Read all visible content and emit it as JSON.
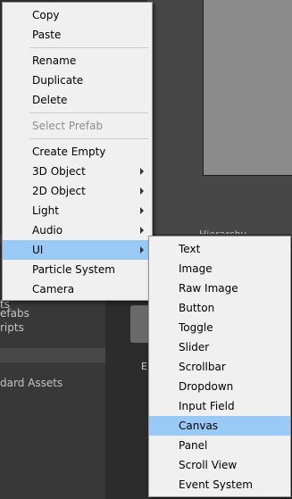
{
  "background": {
    "scene_label": "Hierarchy",
    "project_rows": [
      "ts",
      "efabs",
      "ripts",
      "dard Assets"
    ],
    "asset_label": "E"
  },
  "context_menu": {
    "items": [
      {
        "label": "Copy"
      },
      {
        "label": "Paste"
      },
      {
        "label": "Rename"
      },
      {
        "label": "Duplicate"
      },
      {
        "label": "Delete"
      },
      {
        "label": "Select Prefab",
        "disabled": true
      },
      {
        "label": "Create Empty"
      },
      {
        "label": "3D Object",
        "submenu": true
      },
      {
        "label": "2D Object",
        "submenu": true
      },
      {
        "label": "Light",
        "submenu": true
      },
      {
        "label": "Audio",
        "submenu": true
      },
      {
        "label": "UI",
        "submenu": true,
        "highlighted": true
      },
      {
        "label": "Particle System"
      },
      {
        "label": "Camera"
      }
    ]
  },
  "ui_submenu": {
    "items": [
      {
        "label": "Text"
      },
      {
        "label": "Image"
      },
      {
        "label": "Raw Image"
      },
      {
        "label": "Button"
      },
      {
        "label": "Toggle"
      },
      {
        "label": "Slider"
      },
      {
        "label": "Scrollbar"
      },
      {
        "label": "Dropdown"
      },
      {
        "label": "Input Field"
      },
      {
        "label": "Canvas",
        "highlighted": true
      },
      {
        "label": "Panel"
      },
      {
        "label": "Scroll View"
      },
      {
        "label": "Event System"
      }
    ]
  },
  "colors": {
    "menu_bg": "#f0f0f0",
    "highlight": "#99c9f5",
    "disabled_text": "#8e8e8e",
    "editor_bg": "#2e2e2e"
  }
}
